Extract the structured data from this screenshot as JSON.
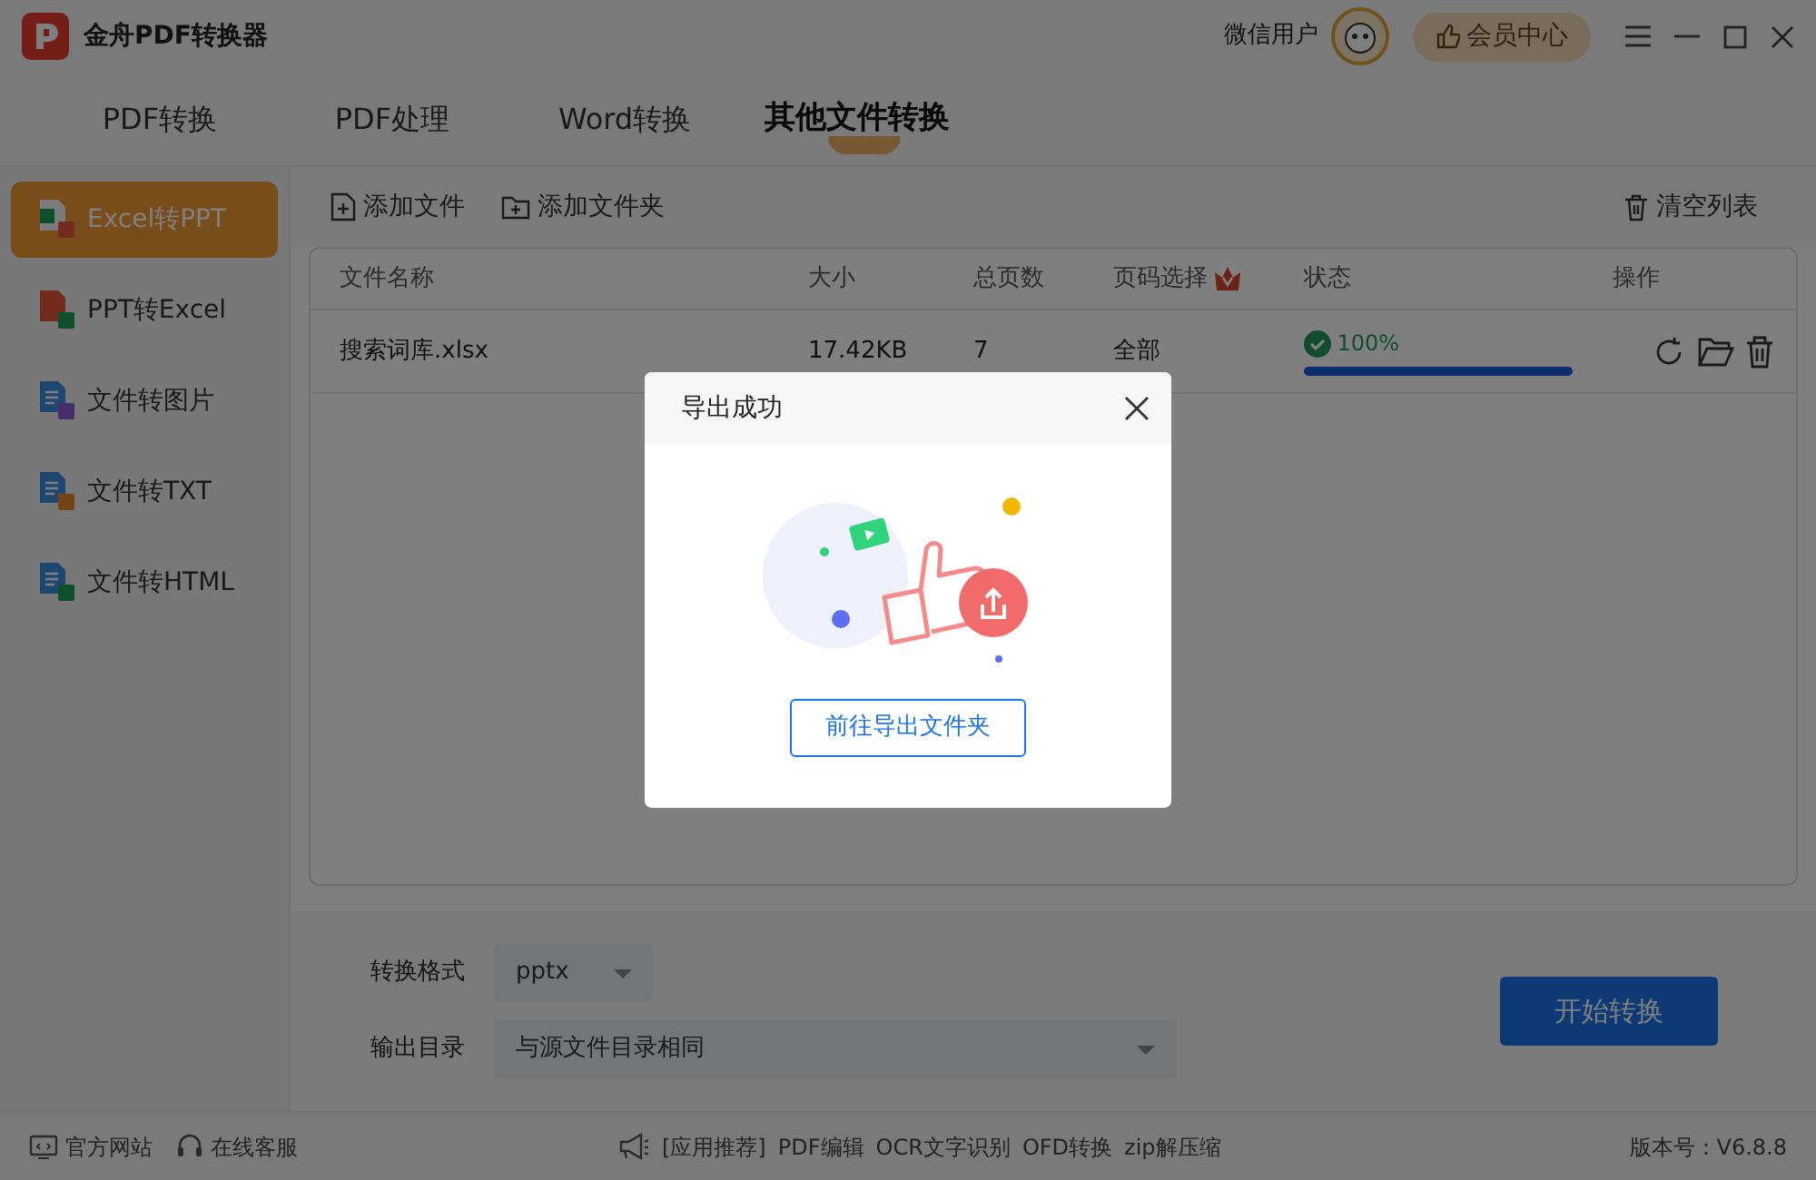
{
  "window": {
    "title": "金舟PDF转换器",
    "user_name": "微信用户",
    "member_button": "会员中心"
  },
  "tabs": [
    {
      "label": "PDF转换",
      "selected": false
    },
    {
      "label": "PDF处理",
      "selected": false
    },
    {
      "label": "Word转换",
      "selected": false
    },
    {
      "label": "其他文件转换",
      "selected": true
    }
  ],
  "sidebar": {
    "items": [
      {
        "label": "Excel转PPT",
        "kind": "excel-ppt",
        "selected": true
      },
      {
        "label": "PPT转Excel",
        "kind": "ppt-excel",
        "selected": false
      },
      {
        "label": "文件转图片",
        "kind": "image",
        "selected": false
      },
      {
        "label": "文件转TXT",
        "kind": "txt",
        "selected": false
      },
      {
        "label": "文件转HTML",
        "kind": "html",
        "selected": false
      }
    ]
  },
  "toolbar": {
    "add_file": "添加文件",
    "add_folder": "添加文件夹",
    "clear_list": "清空列表"
  },
  "table": {
    "columns": [
      {
        "label": "文件名称"
      },
      {
        "label": "大小"
      },
      {
        "label": "总页数"
      },
      {
        "label": "页码选择",
        "vip": true
      },
      {
        "label": "状态"
      },
      {
        "label": "操作"
      }
    ],
    "rows": [
      {
        "name": "搜索词库.xlsx",
        "size": "17.42KB",
        "pages": "7",
        "page_range": "全部",
        "status": "100%",
        "level": 1
      }
    ]
  },
  "settings": {
    "format_label": "转换格式",
    "format_value": "pptx",
    "output_label": "输出目录",
    "output_value": "与源文件目录相同",
    "start_button": "开始转换"
  },
  "status_bar": {
    "left_links": [
      "官方网站",
      "在线客服"
    ],
    "recommend_label": "[应用推荐]",
    "apps": [
      "PDF编辑",
      "OCR文字识别",
      "OFD转换",
      "zip解压缩"
    ],
    "version": "版本号：V6.8.8"
  },
  "dialog": {
    "title": "导出成功",
    "button": "前往导出文件夹"
  }
}
